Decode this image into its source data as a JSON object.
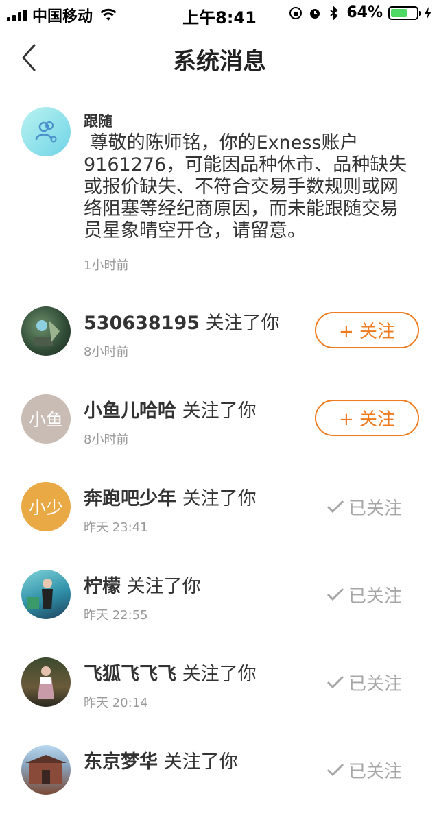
{
  "status_bar": {
    "carrier": "中国移动",
    "time": "上午8:41",
    "battery_text": "64%",
    "battery_level": 0.64
  },
  "nav": {
    "title": "系统消息",
    "back_icon": "chevron-left-icon"
  },
  "system_message": {
    "sender": "跟随",
    "content": " 尊敬的陈师铭，你的Exness账户\n9161276，可能因品种休市、品种缺失\n或报价缺失、不符合交易手数规则或网\n络阻塞等经纪商原因，而未能跟随交易\n员星象晴空开仓，请留意。",
    "time": "1小时前",
    "icon": "follow-users-icon"
  },
  "follows": [
    {
      "name": "530638195",
      "action": " 关注了你",
      "time": "8小时前",
      "avatar_text": "",
      "state": "follow",
      "button_label": "+ 关注"
    },
    {
      "name": "小鱼儿哈哈",
      "action": " 关注了你",
      "time": "8小时前",
      "avatar_text": "小鱼",
      "state": "follow",
      "button_label": "+ 关注"
    },
    {
      "name": "奔跑吧少年",
      "action": " 关注了你",
      "time": "昨天 23:41",
      "avatar_text": "小少",
      "state": "followed",
      "button_label": "已关注"
    },
    {
      "name": "柠檬",
      "action": " 关注了你",
      "time": "昨天 22:55",
      "avatar_text": "",
      "state": "followed",
      "button_label": "已关注"
    },
    {
      "name": "飞狐飞飞飞",
      "action": " 关注了你",
      "time": "昨天 20:14",
      "avatar_text": "",
      "state": "followed",
      "button_label": "已关注"
    },
    {
      "name": "东京梦华",
      "action": " 关注了你",
      "time": "",
      "avatar_text": "",
      "state": "followed",
      "button_label": "已关注"
    }
  ],
  "colors": {
    "accent": "#f07b1e",
    "muted": "#999999",
    "followed": "#a6a6a6"
  }
}
